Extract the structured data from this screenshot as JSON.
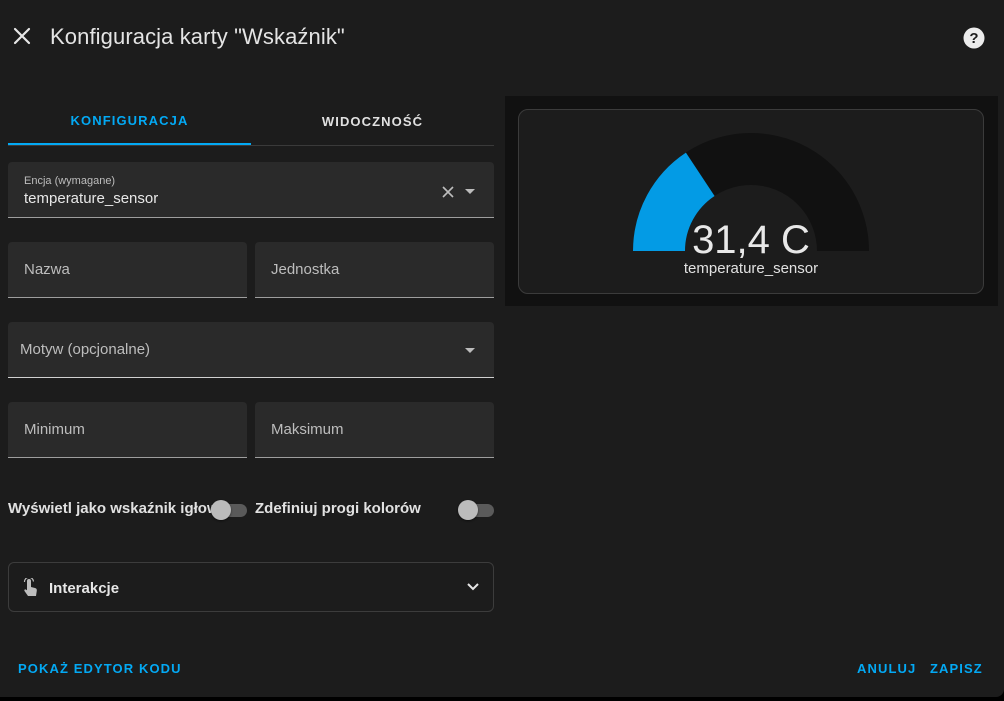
{
  "header": {
    "title": "Konfiguracja karty \"Wskaźnik\""
  },
  "tabs": [
    {
      "label": "KONFIGURACJA",
      "active": true
    },
    {
      "label": "WIDOCZNOŚĆ",
      "active": false
    }
  ],
  "form": {
    "entity": {
      "label": "Encja (wymagane)",
      "value": "temperature_sensor"
    },
    "name": {
      "label": "Nazwa"
    },
    "unit": {
      "label": "Jednostka"
    },
    "theme": {
      "label": "Motyw (opcjonalne)"
    },
    "minimum": {
      "label": "Minimum"
    },
    "maximum": {
      "label": "Maksimum"
    },
    "needle_toggle": {
      "label": "Wyświetl jako wskaźnik igłowy",
      "checked": false
    },
    "severity_toggle": {
      "label": "Zdefiniuj progi kolorów",
      "checked": false
    },
    "interactions": {
      "label": "Interakcje",
      "icon": "gesture-tap-icon"
    }
  },
  "preview": {
    "value_text": "31,4 C",
    "entity_name": "temperature_sensor",
    "gauge_fraction": 0.314,
    "gauge_color": "#039be5",
    "gauge_track_color": "#111111"
  },
  "footer": {
    "code_editor_label": "POKAŻ EDYTOR KODU",
    "cancel_label": "ANULUJ",
    "save_label": "ZAPISZ"
  },
  "colors": {
    "accent": "#03a9f4",
    "background": "#1c1c1c",
    "field_background": "#2a2a2a"
  }
}
